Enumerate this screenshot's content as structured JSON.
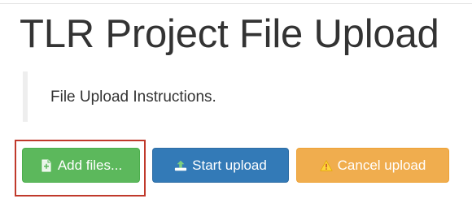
{
  "page": {
    "title": "TLR Project File Upload",
    "instructions": "File Upload Instructions."
  },
  "toolbar": {
    "add_files_label": "Add files...",
    "start_upload_label": "Start upload",
    "cancel_upload_label": "Cancel upload"
  },
  "icons": {
    "add_files": "file-plus-icon",
    "start_upload": "upload-icon",
    "cancel_upload": "warning-icon"
  },
  "colors": {
    "add_button": "#5cb85c",
    "start_button": "#337ab7",
    "cancel_button": "#f0ad4e",
    "highlight": "#c0392b"
  }
}
